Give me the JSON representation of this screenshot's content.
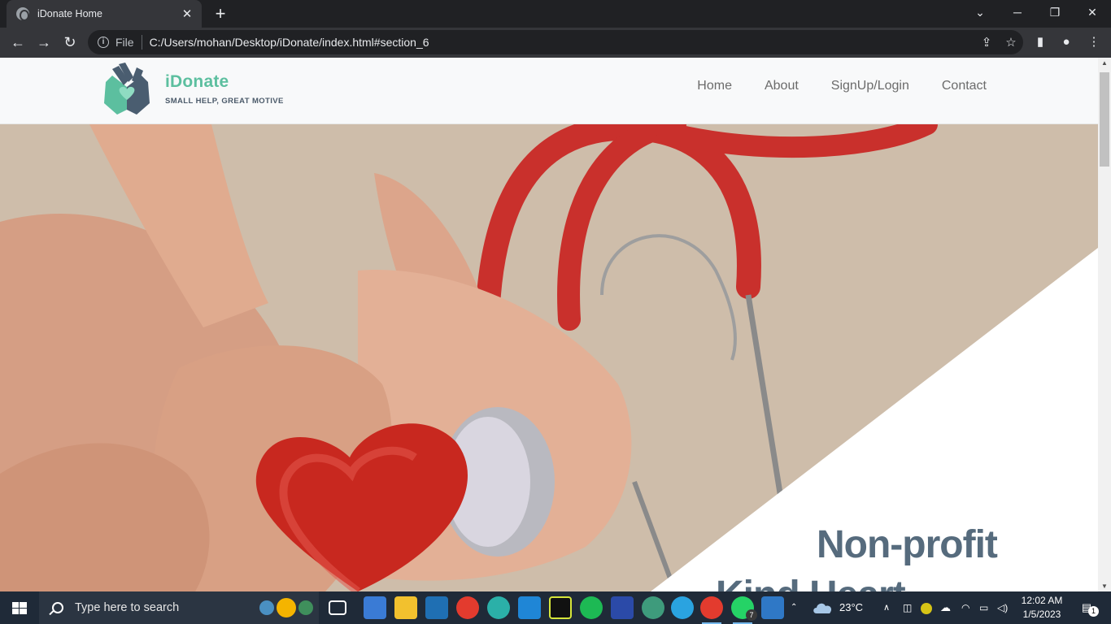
{
  "browser": {
    "tab_title": "iDonate Home",
    "tab_close": "✕",
    "new_tab": "+",
    "scheme_label": "File",
    "url": "C:/Users/mohan/Desktop/iDonate/index.html#section_6"
  },
  "site": {
    "brand": "iDonate",
    "tagline": "SMALL HELP, GREAT MOTIVE",
    "nav": [
      "Home",
      "About",
      "SignUp/Login",
      "Contact"
    ],
    "hero_title": "Non-profit",
    "hero_title_line2": "Kind Heart"
  },
  "taskbar": {
    "search_placeholder": "Type here to search",
    "weather": "23°C",
    "time": "12:02 AM",
    "date": "1/5/2023",
    "whatsapp_badge": "7",
    "notification_count": "1"
  },
  "colors": {
    "brand": "#5cbf9f",
    "heading": "#566b7d",
    "tagline": "#4b5a6a",
    "nav": "#6b6b6b"
  }
}
